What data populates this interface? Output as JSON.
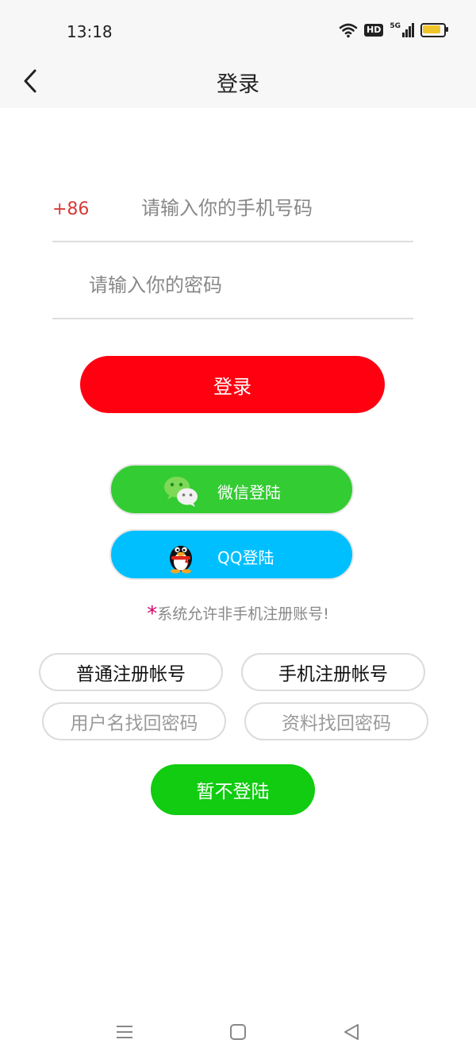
{
  "status_bar": {
    "time": "13:18",
    "hd_badge": "HD",
    "network": "5G",
    "icons": [
      "wifi-icon",
      "hd-icon",
      "signal-5g-icon",
      "battery-icon"
    ],
    "battery_level": 0.85,
    "battery_color": "#f0c52c"
  },
  "header": {
    "title": "登录",
    "back_icon": "chevron-left-icon"
  },
  "form": {
    "country_code": "+86",
    "phone_placeholder": "请输入你的手机号码",
    "phone_value": "",
    "password_placeholder": "请输入你的密码",
    "password_value": "",
    "login_label": "登录"
  },
  "social": {
    "wechat_label": "微信登陆",
    "wechat_icon": "wechat-icon",
    "wechat_color": "#33cc33",
    "qq_label": "QQ登陆",
    "qq_icon": "qq-penguin-icon",
    "qq_color": "#00bfff"
  },
  "note": {
    "star": "*",
    "text": "系统允许非手机注册账号!"
  },
  "options": {
    "register_normal": "普通注册帐号",
    "register_phone": "手机注册帐号",
    "recover_username": "用户名找回密码",
    "recover_profile": "资料找回密码"
  },
  "skip_label": "暂不登陆",
  "colors": {
    "login_button": "#ff0011",
    "skip_button": "#11cc11",
    "country_code": "#d83a3a",
    "note_star": "#d6006a"
  },
  "navbar": {
    "icons": [
      "menu-icon",
      "home-square-icon",
      "back-triangle-icon"
    ]
  }
}
